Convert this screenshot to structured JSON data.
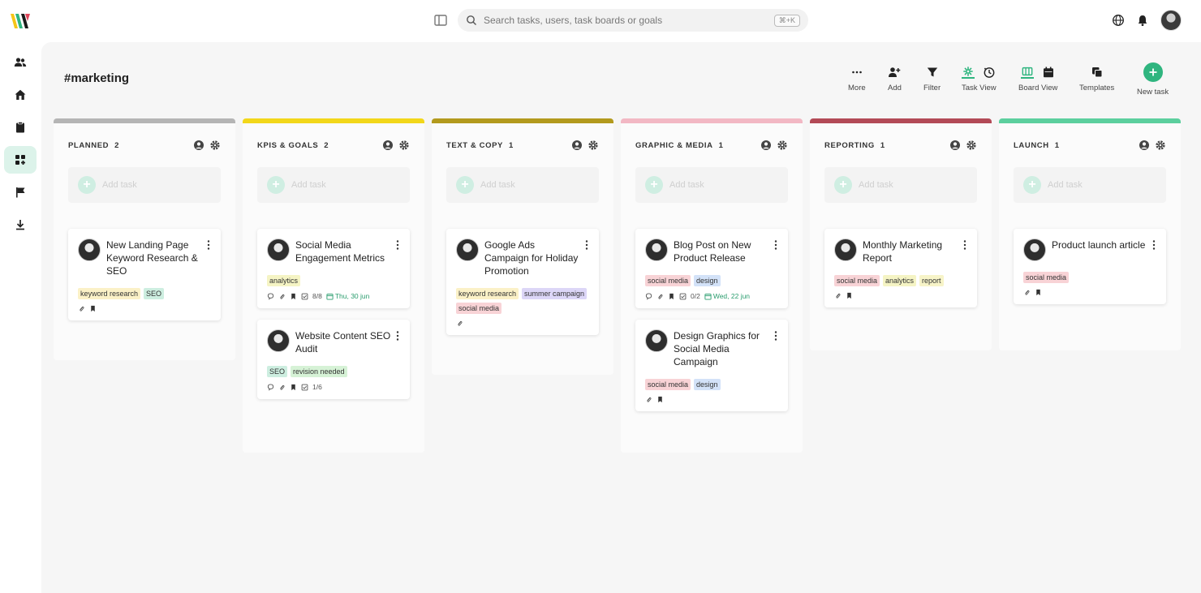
{
  "search": {
    "placeholder": "Search tasks, users, task boards or goals",
    "shortcut": "⌘+K"
  },
  "board": {
    "title": "#marketing"
  },
  "toolbar": {
    "more": "More",
    "add": "Add",
    "filter": "Filter",
    "task_view": "Task View",
    "board_view": "Board View",
    "templates": "Templates",
    "new_task": "New task",
    "accent": "#2fb57f"
  },
  "add_task_label": "Add task",
  "columns": [
    {
      "name": "PLANNED",
      "count": "2",
      "color": "#b5b5b5",
      "cards": [
        {
          "title": "New Landing Page Keyword Research & SEO",
          "tags": [
            {
              "text": "keyword research",
              "color": "#fbf1c7"
            },
            {
              "text": "SEO",
              "color": "#cdeee0"
            }
          ],
          "meta": {
            "comments": false,
            "subtasks": "",
            "due": ""
          }
        }
      ]
    },
    {
      "name": "KPIS & GOALS",
      "count": "2",
      "color": "#f2d71a",
      "cards": [
        {
          "title": "Social Media Engagement Metrics",
          "tags": [
            {
              "text": "analytics",
              "color": "#f5f4c4"
            }
          ],
          "meta": {
            "comments": true,
            "subtasks": "8/8",
            "due": "Thu, 30 jun"
          }
        },
        {
          "title": "Website Content SEO Audit",
          "tags": [
            {
              "text": "SEO",
              "color": "#cdeee0"
            },
            {
              "text": "revision needed",
              "color": "#d6f2d6"
            }
          ],
          "meta": {
            "comments": true,
            "subtasks": "1/6",
            "due": ""
          }
        }
      ]
    },
    {
      "name": "TEXT & COPY",
      "count": "1",
      "color": "#b39a1d",
      "cards": [
        {
          "title": "Google Ads Campaign for Holiday Promotion",
          "tags": [
            {
              "text": "keyword research",
              "color": "#fbf1c7"
            },
            {
              "text": "summer campaign",
              "color": "#dcd6f7"
            },
            {
              "text": "social media",
              "color": "#f8d3d6"
            }
          ],
          "meta": {
            "comments": false,
            "subtasks": "",
            "due": "",
            "clip_only": true
          }
        }
      ]
    },
    {
      "name": "GRAPHIC & MEDIA",
      "count": "1",
      "color": "#f2b8c4",
      "cards": [
        {
          "title": "Blog Post on New Product Release",
          "tags": [
            {
              "text": "social media",
              "color": "#f8d3d6"
            },
            {
              "text": "design",
              "color": "#d3e2f8"
            }
          ],
          "meta": {
            "comments": true,
            "subtasks": "0/2",
            "due": "Wed, 22 jun"
          }
        },
        {
          "title": "Design Graphics for Social Media Campaign",
          "tags": [
            {
              "text": "social media",
              "color": "#f8d3d6"
            },
            {
              "text": "design",
              "color": "#d3e2f8"
            }
          ],
          "meta": {
            "comments": false,
            "subtasks": "",
            "due": ""
          }
        }
      ]
    },
    {
      "name": "REPORTING",
      "count": "1",
      "color": "#b34a57",
      "cards": [
        {
          "title": "Monthly Marketing Report",
          "tags": [
            {
              "text": "social media",
              "color": "#f8d3d6"
            },
            {
              "text": "analytics",
              "color": "#f5f4c4"
            },
            {
              "text": "report",
              "color": "#f7f4c8"
            }
          ],
          "meta": {
            "comments": false,
            "subtasks": "",
            "due": ""
          }
        }
      ]
    },
    {
      "name": "LAUNCH",
      "count": "1",
      "color": "#5ccf9e",
      "cards": [
        {
          "title": "Product launch article",
          "tags": [
            {
              "text": "social media",
              "color": "#f8d3d6"
            }
          ],
          "meta": {
            "comments": false,
            "subtasks": "",
            "due": ""
          }
        }
      ]
    }
  ]
}
